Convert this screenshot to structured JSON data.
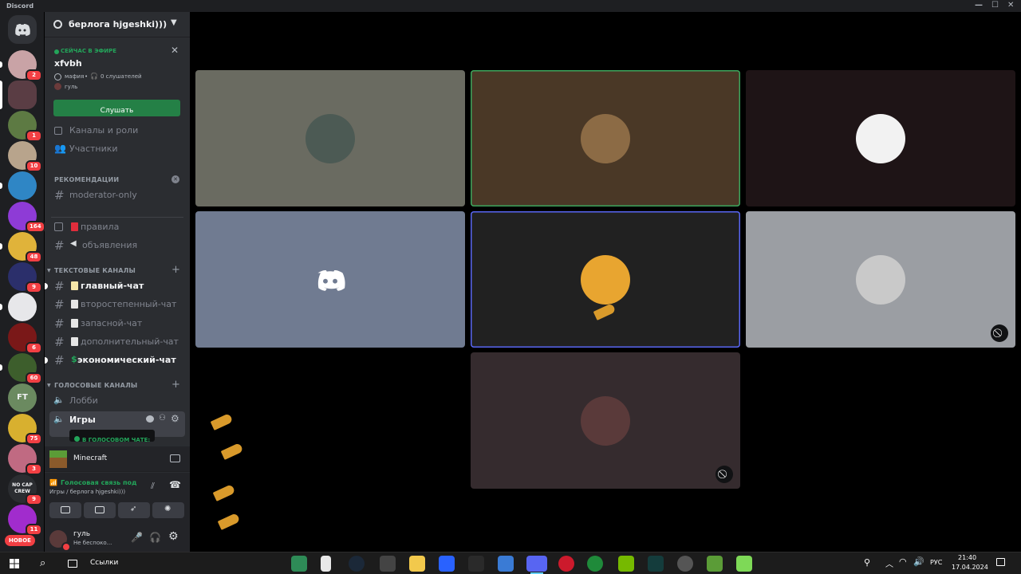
{
  "window": {
    "title": "Discord"
  },
  "server": {
    "name": "берлога hjgeshki)))"
  },
  "stage_banner": {
    "live_label": "СЕЙЧАС В ЭФИРЕ",
    "stage_name": "xfvbh",
    "topic": "мафия",
    "separator": "•",
    "listeners": "0 слушателей",
    "host": "гуль",
    "listen_button": "Слушать"
  },
  "nav": [
    {
      "label": "Каналы и роли",
      "icon": "channels-roles-icon"
    },
    {
      "label": "Участники",
      "icon": "members-icon"
    }
  ],
  "recommendations": {
    "title": "РЕКОМЕНДАЦИИ",
    "items": [
      {
        "label": "moderator-only"
      }
    ]
  },
  "pinned_channels": [
    {
      "label": "правила",
      "icon": "rules-icon"
    },
    {
      "label": "объявления",
      "icon": "announcement-icon"
    }
  ],
  "text_section": {
    "title": "ТЕКСТОВЫЕ КАНАЛЫ"
  },
  "text_channels": [
    {
      "label": "главный-чат",
      "unread": true
    },
    {
      "label": "второстепенный-чат",
      "unread": false
    },
    {
      "label": "запасной-чат",
      "unread": false
    },
    {
      "label": "дополнительный-чат",
      "unread": false
    },
    {
      "label": "экономический-чат",
      "unread": true
    }
  ],
  "voice_section": {
    "title": "ГОЛОСОВЫЕ КАНАЛЫ"
  },
  "voice_channels": [
    {
      "label": "Лобби"
    },
    {
      "label": "Игры"
    }
  ],
  "voice_tooltip": "В ГОЛОСОВОМ ЧАТЕ:",
  "activity": {
    "label": "Minecraft"
  },
  "voice_panel": {
    "status": "Голосовая связь под",
    "location": "Игры / берлога hjgeshki)))"
  },
  "user": {
    "name": "гуль",
    "status": "Не беспоко..."
  },
  "guilds": [
    {
      "badge": "2",
      "color": "#c9a3a6"
    },
    {
      "badge": "",
      "color": "#5a3d44",
      "selected": true
    },
    {
      "badge": "1",
      "color": "#5d7a43"
    },
    {
      "badge": "10",
      "color": "#b8a48c"
    },
    {
      "badge": "",
      "color": "#2f86c5"
    },
    {
      "badge": "164",
      "color": "#8e3bd6"
    },
    {
      "badge": "48",
      "color": "#e0b33a"
    },
    {
      "badge": "9",
      "color": "#2b2f6b"
    },
    {
      "badge": "",
      "color": "#e7e7ea"
    },
    {
      "badge": "6",
      "color": "#7a1818"
    },
    {
      "badge": "60",
      "color": "#3d5e2c"
    },
    {
      "badge": "",
      "color": "#6b8a60",
      "text": "FT"
    },
    {
      "badge": "75",
      "color": "#d8b02f"
    },
    {
      "badge": "3",
      "color": "#c06a82"
    },
    {
      "badge": "9",
      "color": "#2b2d31",
      "text": "NO CAP CREW"
    },
    {
      "badge": "11",
      "color": "#a12ccd"
    }
  ],
  "new_badge": "НОВОЕ",
  "taskbar": {
    "search": "Ссылки",
    "lang": "РУС",
    "time": "21:40",
    "date": "17.04.2024"
  },
  "tiles": [
    {
      "bg": "#6a6b61",
      "border": "",
      "avatar": "#4c5a54"
    },
    {
      "bg": "#4a3826",
      "border": "#3ba55c",
      "avatar": "#8c6b45"
    },
    {
      "bg": "#1e1416",
      "border": "",
      "avatar": "#f2f2f2"
    },
    {
      "bg": "#707b91",
      "border": "",
      "avatar": "discord"
    },
    {
      "bg": "#212121",
      "border": "#5865f2",
      "avatar": "#e8a530"
    },
    {
      "bg": "#9b9ea3",
      "border": "",
      "avatar": "#c9c9c9"
    },
    {
      "bg": "#352b2e",
      "border": "",
      "avatar": "#5a3a3a"
    }
  ]
}
